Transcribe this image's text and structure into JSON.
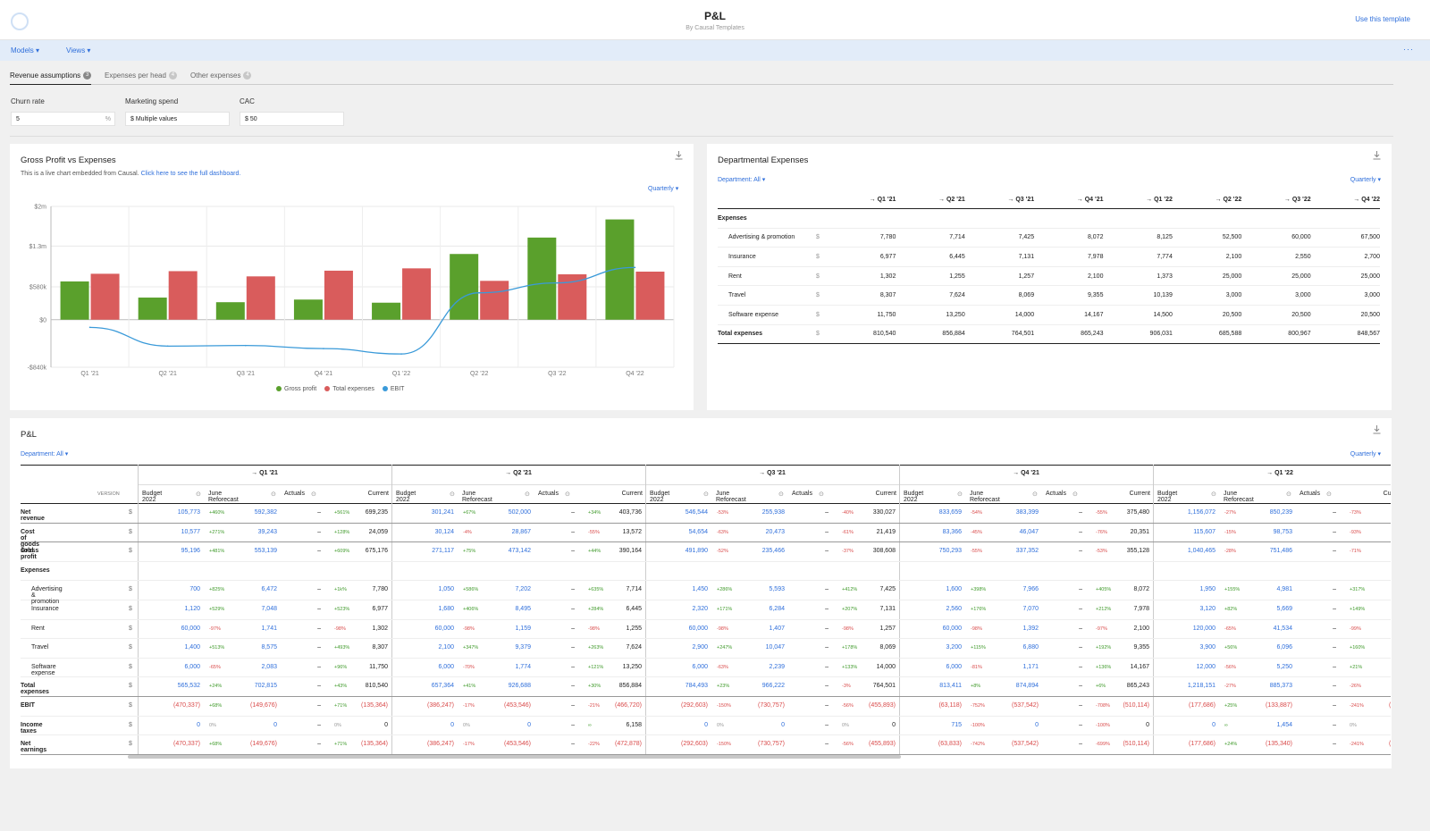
{
  "header": {
    "title": "P&L",
    "subtitle": "By Causal Templates",
    "use_template": "Use this template"
  },
  "menu": {
    "models": "Models ▾",
    "views": "Views ▾",
    "more": "···"
  },
  "tabs": [
    {
      "label": "Revenue assumptions",
      "badge": "3"
    },
    {
      "label": "Expenses per head",
      "badge": "4"
    },
    {
      "label": "Other expenses",
      "badge": "4"
    }
  ],
  "inputs": {
    "churn": {
      "label": "Churn rate",
      "value": "5",
      "suffix": "%"
    },
    "marketing": {
      "label": "Marketing spend",
      "value": "$ Multiple values"
    },
    "cac": {
      "label": "CAC",
      "value": "$ 50"
    }
  },
  "gross_card": {
    "title": "Gross Profit vs Expenses",
    "note_prefix": "This is a live chart embedded from Causal. ",
    "note_link": "Click here to see the full dashboard.",
    "period": "Quarterly ▾"
  },
  "chart_data": {
    "type": "bar",
    "categories": [
      "Q1 '21",
      "Q2 '21",
      "Q3 '21",
      "Q4 '21",
      "Q1 '22",
      "Q2 '22",
      "Q3 '22",
      "Q4 '22"
    ],
    "y_ticks": [
      "$2m",
      "$1.3m",
      "$580k",
      "$0",
      "-$840k"
    ],
    "ylim": [
      -840000,
      2000000
    ],
    "series": [
      {
        "name": "Gross profit",
        "color": "#5aa02c",
        "kind": "bar",
        "values": [
          675176,
          390164,
          308608,
          355128,
          300000,
          1160000,
          1450000,
          1770000
        ]
      },
      {
        "name": "Total expenses",
        "color": "#d95c5c",
        "kind": "bar",
        "values": [
          810540,
          856884,
          764501,
          865243,
          906031,
          685588,
          800967,
          848567
        ]
      },
      {
        "name": "EBIT",
        "color": "#3a9ad9",
        "kind": "line",
        "values": [
          -135364,
          -466720,
          -455893,
          -510114,
          -605000,
          474412,
          649033,
          921433
        ]
      }
    ]
  },
  "dept_card": {
    "title": "Departmental Expenses",
    "filter": "Department: All ▾",
    "period": "Quarterly ▾",
    "columns": [
      "→ Q1 '21",
      "→ Q2 '21",
      "→ Q3 '21",
      "→ Q4 '21",
      "→ Q1 '22",
      "→ Q2 '22",
      "→ Q3 '22",
      "→ Q4 '22"
    ],
    "section": "Expenses",
    "rows": [
      {
        "name": "Advertising & promotion",
        "unit": "$",
        "values": [
          "7,780",
          "7,714",
          "7,425",
          "8,072",
          "8,125",
          "52,500",
          "60,000",
          "67,500"
        ]
      },
      {
        "name": "Insurance",
        "unit": "$",
        "values": [
          "6,977",
          "6,445",
          "7,131",
          "7,978",
          "7,774",
          "2,100",
          "2,550",
          "2,700"
        ]
      },
      {
        "name": "Rent",
        "unit": "$",
        "values": [
          "1,302",
          "1,255",
          "1,257",
          "2,100",
          "1,373",
          "25,000",
          "25,000",
          "25,000"
        ]
      },
      {
        "name": "Travel",
        "unit": "$",
        "values": [
          "8,307",
          "7,624",
          "8,069",
          "9,355",
          "10,139",
          "3,000",
          "3,000",
          "3,000"
        ]
      },
      {
        "name": "Software expense",
        "unit": "$",
        "values": [
          "11,750",
          "13,250",
          "14,000",
          "14,167",
          "14,500",
          "20,500",
          "20,500",
          "20,500"
        ]
      }
    ],
    "total": {
      "name": "Total expenses",
      "unit": "$",
      "values": [
        "810,540",
        "856,884",
        "764,501",
        "865,243",
        "906,031",
        "685,588",
        "800,967",
        "848,567"
      ]
    }
  },
  "pl_card": {
    "title": "P&L",
    "filter": "Department: All ▾",
    "period": "Quarterly ▾",
    "version_label": "VERSION",
    "quarters": [
      "→ Q1 '21",
      "→ Q2 '21",
      "→ Q3 '21",
      "→ Q4 '21",
      "→ Q1 '22"
    ],
    "subcols": [
      "Budget 2022",
      "June Reforecast",
      "Actuals",
      "Current"
    ],
    "rows": [
      {
        "name": "Net revenue",
        "bold": true,
        "unit": "$",
        "q": [
          [
            "105,773",
            "+460%",
            "592,382",
            "–",
            "+561%",
            "699,235"
          ],
          [
            "301,241",
            "+67%",
            "502,000",
            "–",
            "+34%",
            "403,736"
          ],
          [
            "546,544",
            "-53%",
            "255,938",
            "–",
            "-40%",
            "330,027"
          ],
          [
            "833,659",
            "-54%",
            "383,399",
            "–",
            "-55%",
            "375,480"
          ],
          [
            "1,156,072",
            "-27%",
            "850,239",
            "–",
            "-73%",
            "307,"
          ]
        ]
      },
      {
        "name": "Cost of goods sold",
        "bold": true,
        "unit": "$",
        "q": [
          [
            "10,577",
            "+271%",
            "39,243",
            "–",
            "+128%",
            "24,059"
          ],
          [
            "30,124",
            "-4%",
            "28,867",
            "–",
            "-55%",
            "13,572"
          ],
          [
            "54,654",
            "-63%",
            "20,473",
            "–",
            "-61%",
            "21,419"
          ],
          [
            "83,366",
            "-45%",
            "46,047",
            "–",
            "-76%",
            "20,351"
          ],
          [
            "115,607",
            "-15%",
            "98,753",
            "–",
            "-93%",
            "7,"
          ]
        ]
      },
      {
        "name": "Gross profit",
        "bold": true,
        "unit": "$",
        "q": [
          [
            "95,196",
            "+481%",
            "553,139",
            "–",
            "+609%",
            "675,176"
          ],
          [
            "271,117",
            "+75%",
            "473,142",
            "–",
            "+44%",
            "390,164"
          ],
          [
            "491,890",
            "-52%",
            "235,466",
            "–",
            "-37%",
            "308,608"
          ],
          [
            "750,293",
            "-55%",
            "337,352",
            "–",
            "-53%",
            "355,128"
          ],
          [
            "1,040,465",
            "-28%",
            "751,486",
            "–",
            "-71%",
            "300"
          ]
        ]
      },
      {
        "name": "Expenses",
        "bold": true,
        "section": true,
        "unit": "",
        "q": []
      },
      {
        "name": "Advertising & promotion",
        "indent": true,
        "unit": "$",
        "q": [
          [
            "700",
            "+825%",
            "6,472",
            "–",
            "+1k%",
            "7,780"
          ],
          [
            "1,050",
            "+586%",
            "7,202",
            "–",
            "+635%",
            "7,714"
          ],
          [
            "1,450",
            "+286%",
            "5,593",
            "–",
            "+412%",
            "7,425"
          ],
          [
            "1,600",
            "+398%",
            "7,966",
            "–",
            "+405%",
            "8,072"
          ],
          [
            "1,950",
            "+155%",
            "4,981",
            "–",
            "+317%",
            "8,"
          ]
        ]
      },
      {
        "name": "Insurance",
        "indent": true,
        "unit": "$",
        "q": [
          [
            "1,120",
            "+529%",
            "7,048",
            "–",
            "+523%",
            "6,977"
          ],
          [
            "1,680",
            "+406%",
            "8,495",
            "–",
            "+284%",
            "6,445"
          ],
          [
            "2,320",
            "+171%",
            "6,284",
            "–",
            "+207%",
            "7,131"
          ],
          [
            "2,560",
            "+176%",
            "7,070",
            "–",
            "+212%",
            "7,978"
          ],
          [
            "3,120",
            "+82%",
            "5,669",
            "–",
            "+149%",
            "7,"
          ]
        ]
      },
      {
        "name": "Rent",
        "indent": true,
        "unit": "$",
        "q": [
          [
            "60,000",
            "-97%",
            "1,741",
            "–",
            "-98%",
            "1,302"
          ],
          [
            "60,000",
            "-98%",
            "1,159",
            "–",
            "-98%",
            "1,255"
          ],
          [
            "60,000",
            "-98%",
            "1,407",
            "–",
            "-98%",
            "1,257"
          ],
          [
            "60,000",
            "-98%",
            "1,392",
            "–",
            "-97%",
            "2,100"
          ],
          [
            "120,000",
            "-65%",
            "41,534",
            "–",
            "-99%",
            "1,"
          ]
        ]
      },
      {
        "name": "Travel",
        "indent": true,
        "unit": "$",
        "q": [
          [
            "1,400",
            "+513%",
            "8,575",
            "–",
            "+493%",
            "8,307"
          ],
          [
            "2,100",
            "+347%",
            "9,379",
            "–",
            "+263%",
            "7,624"
          ],
          [
            "2,900",
            "+247%",
            "10,047",
            "–",
            "+178%",
            "8,069"
          ],
          [
            "3,200",
            "+115%",
            "6,880",
            "–",
            "+192%",
            "9,355"
          ],
          [
            "3,900",
            "+56%",
            "6,096",
            "–",
            "+160%",
            "10,"
          ]
        ]
      },
      {
        "name": "Software expense",
        "indent": true,
        "unit": "$",
        "q": [
          [
            "6,000",
            "-65%",
            "2,083",
            "–",
            "+96%",
            "11,750"
          ],
          [
            "6,000",
            "-70%",
            "1,774",
            "–",
            "+121%",
            "13,250"
          ],
          [
            "6,000",
            "-63%",
            "2,239",
            "–",
            "+133%",
            "14,000"
          ],
          [
            "6,000",
            "-81%",
            "1,171",
            "–",
            "+136%",
            "14,167"
          ],
          [
            "12,000",
            "-56%",
            "5,250",
            "–",
            "+21%",
            "14,"
          ]
        ]
      },
      {
        "name": "Total expenses",
        "bold": true,
        "unit": "$",
        "q": [
          [
            "565,532",
            "+24%",
            "702,815",
            "–",
            "+43%",
            "810,540"
          ],
          [
            "657,364",
            "+41%",
            "926,688",
            "–",
            "+30%",
            "856,884"
          ],
          [
            "784,493",
            "+23%",
            "966,222",
            "–",
            "-3%",
            "764,501"
          ],
          [
            "813,411",
            "+8%",
            "874,894",
            "–",
            "+6%",
            "865,243"
          ],
          [
            "1,218,151",
            "-27%",
            "885,373",
            "–",
            "-26%",
            "906,"
          ]
        ]
      },
      {
        "name": "EBIT",
        "bold": true,
        "unit": "$",
        "neg": true,
        "q": [
          [
            "(470,337)",
            "+68%",
            "(149,676)",
            "–",
            "+71%",
            "(135,364)"
          ],
          [
            "(386,247)",
            "-17%",
            "(453,546)",
            "–",
            "-21%",
            "(466,720)"
          ],
          [
            "(292,603)",
            "-150%",
            "(730,757)",
            "–",
            "-56%",
            "(455,893)"
          ],
          [
            "(63,118)",
            "-752%",
            "(537,542)",
            "–",
            "-708%",
            "(510,114)"
          ],
          [
            "(177,686)",
            "+25%",
            "(133,887)",
            "–",
            "-241%",
            "(605,"
          ]
        ]
      },
      {
        "name": "Income taxes",
        "bold": true,
        "unit": "$",
        "q": [
          [
            "0",
            "0%",
            "0",
            "–",
            "0%",
            "0"
          ],
          [
            "0",
            "0%",
            "0",
            "–",
            "∞",
            "6,158"
          ],
          [
            "0",
            "0%",
            "0",
            "–",
            "0%",
            "0"
          ],
          [
            "715",
            "-100%",
            "0",
            "–",
            "-100%",
            "0"
          ],
          [
            "0",
            "∞",
            "1,454",
            "–",
            "0%",
            ""
          ]
        ]
      },
      {
        "name": "Net earnings",
        "bold": true,
        "unit": "$",
        "neg": true,
        "q": [
          [
            "(470,337)",
            "+68%",
            "(149,676)",
            "–",
            "+71%",
            "(135,364)"
          ],
          [
            "(386,247)",
            "-17%",
            "(453,546)",
            "–",
            "-22%",
            "(472,878)"
          ],
          [
            "(292,603)",
            "-150%",
            "(730,757)",
            "–",
            "-56%",
            "(455,893)"
          ],
          [
            "(63,833)",
            "-742%",
            "(537,542)",
            "–",
            "-699%",
            "(510,114)"
          ],
          [
            "(177,686)",
            "+24%",
            "(135,340)",
            "–",
            "-241%",
            "(605,"
          ]
        ]
      }
    ]
  }
}
